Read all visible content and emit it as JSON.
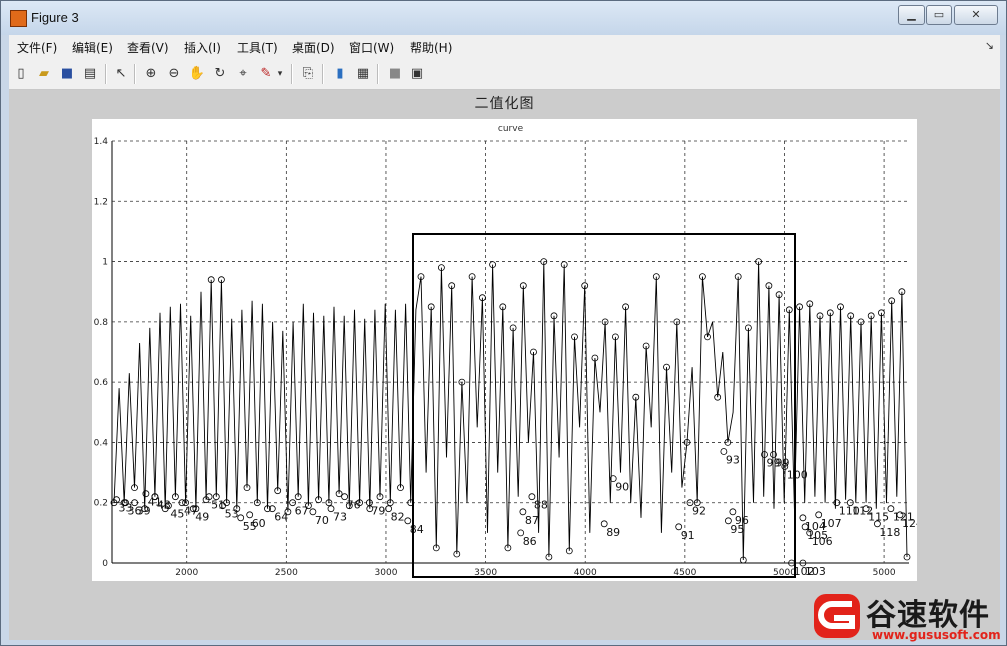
{
  "window": {
    "title": "Figure 3"
  },
  "menus": [
    "文件(F)",
    "编辑(E)",
    "查看(V)",
    "插入(I)",
    "工具(T)",
    "桌面(D)",
    "窗口(W)",
    "帮助(H)"
  ],
  "figure": {
    "title": "二值化图"
  },
  "chart_data": {
    "type": "line",
    "title": "curve",
    "xlabel": "",
    "ylabel": "",
    "xlim": [
      2000,
      5060
    ],
    "ylim": [
      0,
      1.4
    ],
    "x_ticks": [
      3000,
      3500,
      4000,
      4500,
      5000
    ],
    "x_tick_labels_all": [
      "2000",
      "2500",
      "3000",
      "3500",
      "4000",
      "4500",
      "5000",
      "5000"
    ],
    "y_ticks": [
      0,
      0.2,
      0.4,
      0.6,
      0.8,
      1,
      1.2,
      1.4
    ],
    "y_tick_labels": [
      "0",
      "0.2",
      "0.4",
      "0.6",
      "0.8",
      "1",
      "1.2",
      "1.4"
    ],
    "grid": true,
    "series": [
      {
        "values": [
          0.2,
          0.58,
          0.2,
          0.63,
          0.25,
          0.73,
          0.18,
          0.78,
          0.22,
          0.83,
          0.18,
          0.85,
          0.22,
          0.86,
          0.2,
          0.82,
          0.18,
          0.9,
          0.21,
          0.94,
          0.22,
          0.94,
          0.2,
          0.81,
          0.18,
          0.84,
          0.25,
          0.87,
          0.2,
          0.86,
          0.18,
          0.8,
          0.24,
          0.77,
          0.17,
          0.8,
          0.22,
          0.86,
          0.19,
          0.83,
          0.21,
          0.82,
          0.2,
          0.85,
          0.23,
          0.82,
          0.19,
          0.84,
          0.2,
          0.81,
          0.18,
          0.84,
          0.22,
          0.86,
          0.2,
          0.84,
          0.25,
          0.86,
          0.2,
          0.84,
          0.95,
          0.3,
          0.85,
          0.05,
          0.98,
          0.35,
          0.92,
          0.03,
          0.6,
          0.2,
          0.95,
          0.45,
          0.88,
          0.1,
          0.99,
          0.3,
          0.85,
          0.05,
          0.78,
          0.22,
          0.92,
          0.4,
          0.7,
          0.1,
          1.0,
          0.02,
          0.82,
          0.35,
          0.99,
          0.04,
          0.75,
          0.45,
          0.92,
          0.1,
          0.68,
          0.5,
          0.8,
          0.2,
          0.75,
          0.3,
          0.85,
          0.2,
          0.55,
          0.15,
          0.72,
          0.45,
          0.95,
          0.1,
          0.65,
          0.3,
          0.8,
          0.25,
          0.4,
          0.65,
          0.2,
          0.95,
          0.75,
          0.8,
          0.55,
          0.7,
          0.4,
          0.5,
          0.95,
          0.01,
          0.78,
          0.2,
          1.0,
          0.22,
          0.92,
          0.18,
          0.89,
          0.2,
          0.84,
          0.18,
          0.85,
          0.2,
          0.86,
          0.22,
          0.82,
          0.2,
          0.83,
          0.18,
          0.85,
          0.21,
          0.82,
          0.2,
          0.8,
          0.2,
          0.82,
          0.18,
          0.83,
          0.2,
          0.87,
          0.22,
          0.9,
          0.02
        ]
      }
    ],
    "points": [
      {
        "x": 2010,
        "y": 0.21,
        "label": "33"
      },
      {
        "x": 2050,
        "y": 0.2,
        "label": "36"
      },
      {
        "x": 2090,
        "y": 0.2,
        "label": "39"
      },
      {
        "x": 2140,
        "y": 0.23,
        "label": "41"
      },
      {
        "x": 2180,
        "y": 0.22,
        "label": "43"
      },
      {
        "x": 2240,
        "y": 0.19,
        "label": "45"
      },
      {
        "x": 2300,
        "y": 0.2,
        "label": "47"
      },
      {
        "x": 2350,
        "y": 0.18,
        "label": "49"
      },
      {
        "x": 2420,
        "y": 0.22,
        "label": "51"
      },
      {
        "x": 2480,
        "y": 0.19,
        "label": "53"
      },
      {
        "x": 2560,
        "y": 0.15,
        "label": "55"
      },
      {
        "x": 2600,
        "y": 0.16,
        "label": "60"
      },
      {
        "x": 2700,
        "y": 0.18,
        "label": "64"
      },
      {
        "x": 2790,
        "y": 0.2,
        "label": "67"
      },
      {
        "x": 2880,
        "y": 0.17,
        "label": "70"
      },
      {
        "x": 2960,
        "y": 0.18,
        "label": "73"
      },
      {
        "x": 3020,
        "y": 0.22,
        "label": "76"
      },
      {
        "x": 3130,
        "y": 0.2,
        "label": "79"
      },
      {
        "x": 3215,
        "y": 0.18,
        "label": "82"
      },
      {
        "x": 3300,
        "y": 0.14,
        "label": "84"
      },
      {
        "x": 3800,
        "y": 0.1,
        "label": "86"
      },
      {
        "x": 3810,
        "y": 0.17,
        "label": "87"
      },
      {
        "x": 3850,
        "y": 0.22,
        "label": "88"
      },
      {
        "x": 4170,
        "y": 0.13,
        "label": "89"
      },
      {
        "x": 4210,
        "y": 0.28,
        "label": "90"
      },
      {
        "x": 4500,
        "y": 0.12,
        "label": "91"
      },
      {
        "x": 4550,
        "y": 0.2,
        "label": "92"
      },
      {
        "x": 4700,
        "y": 0.37,
        "label": "93"
      },
      {
        "x": 4720,
        "y": 0.14,
        "label": "95"
      },
      {
        "x": 4740,
        "y": 0.17,
        "label": "96"
      },
      {
        "x": 4880,
        "y": 0.36,
        "label": "99"
      },
      {
        "x": 4920,
        "y": 0.36,
        "label": "99"
      },
      {
        "x": 4970,
        "y": 0.32,
        "label": "100"
      },
      {
        "x": 5000,
        "y": 0.0,
        "label": "102"
      },
      {
        "x": 5050,
        "y": 0.0,
        "label": "103"
      },
      {
        "x": 5050,
        "y": 0.15,
        "label": "104"
      },
      {
        "x": 5060,
        "y": 0.12,
        "label": "105"
      },
      {
        "x": 5080,
        "y": 0.1,
        "label": "106"
      },
      {
        "x": 5120,
        "y": 0.16,
        "label": "107"
      },
      {
        "x": 5200,
        "y": 0.2,
        "label": "110"
      },
      {
        "x": 5260,
        "y": 0.2,
        "label": "112"
      },
      {
        "x": 5330,
        "y": 0.18,
        "label": "115"
      },
      {
        "x": 5380,
        "y": 0.13,
        "label": "118"
      },
      {
        "x": 5440,
        "y": 0.18,
        "label": "121"
      },
      {
        "x": 5480,
        "y": 0.16,
        "label": "124"
      }
    ]
  },
  "watermark": {
    "name": "谷速软件",
    "url": "www.gususoft.com"
  }
}
